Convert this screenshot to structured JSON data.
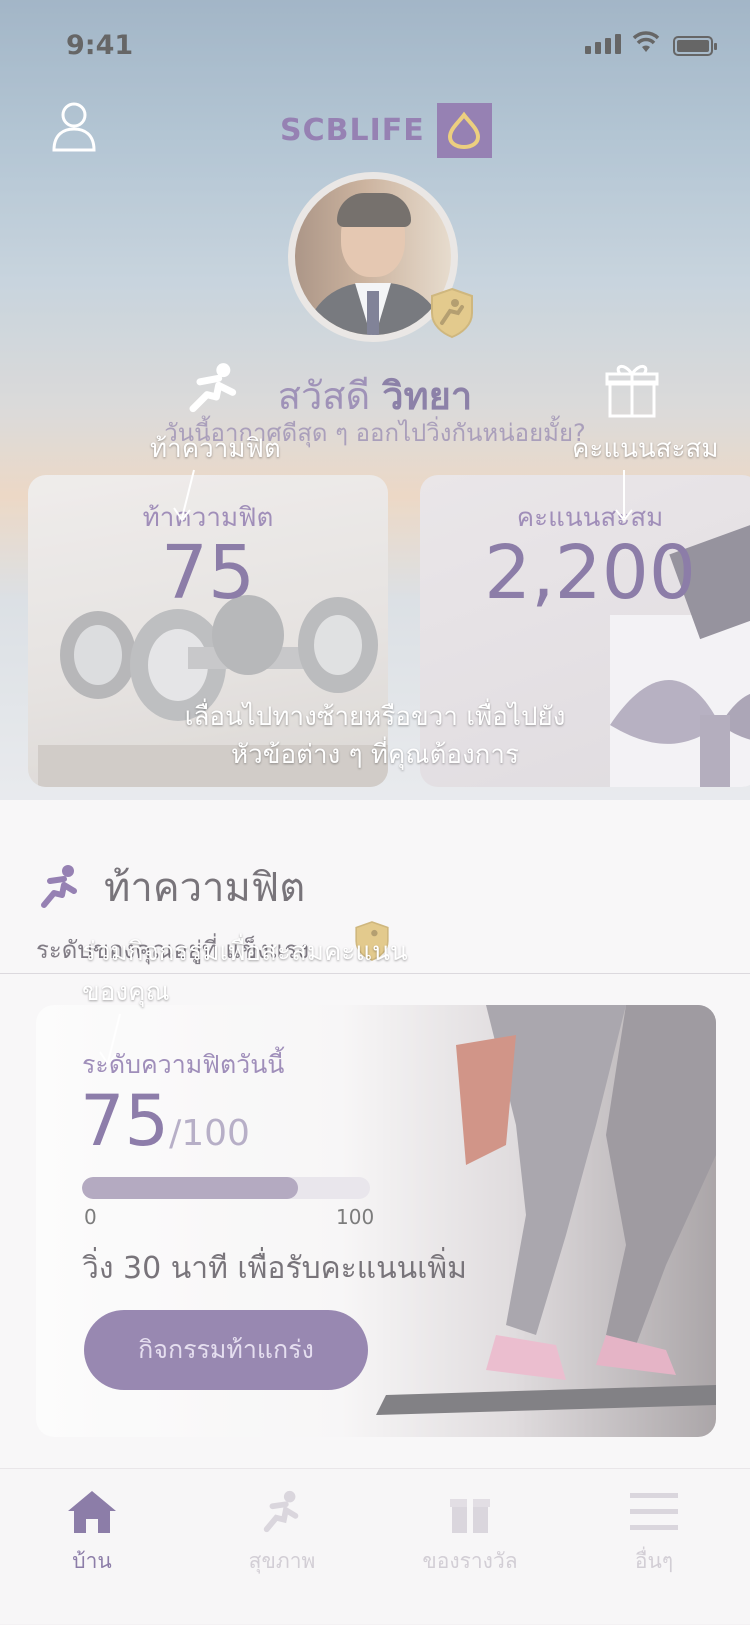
{
  "status": {
    "time": "9:41"
  },
  "header": {
    "logo_text": "SCBLIFE"
  },
  "greeting": {
    "prefix": "สวัสดี",
    "name": "วิทยา",
    "subtitle": "วันนี้อากาศดีสุด ๆ ออกไปวิ่งกันหน่อยมั้ย?"
  },
  "cards": [
    {
      "label": "ท้าความฟิต",
      "value": "75"
    },
    {
      "label": "คะแนนสะสม",
      "value": "2,200"
    }
  ],
  "section": {
    "title": "ท้าความฟิต",
    "subtitle": "ระดับของคุณอยู่ที่ แข็งแรง"
  },
  "fitness": {
    "label": "ระดับความฟิตวันนี้",
    "score": "75",
    "max": "/100",
    "progress": 0.75,
    "range_min": "0",
    "range_max": "100",
    "note": "วิ่ง 30 นาที เพื่อรับคะแนนเพิ่ม",
    "button": "กิจกรรมท้าแกร่ง"
  },
  "tabs": [
    {
      "label": "บ้าน",
      "icon": "home-icon",
      "active": true
    },
    {
      "label": "สุขภาพ",
      "icon": "runner-icon",
      "active": false
    },
    {
      "label": "ของรางวัล",
      "icon": "gift-icon",
      "active": false
    },
    {
      "label": "อื่นๆ",
      "icon": "menu-icon",
      "active": false
    }
  ],
  "coachmarks": {
    "fit": "ท้าความฟิต",
    "points": "คะแนนสะสม",
    "swipe_line1": "เลื่อนไปทางซ้ายหรือขวา เพื่อไปยัง",
    "swipe_line2": "หัวข้อต่าง ๆ ที่คุณต้องการ",
    "join_line1": "ร่วมกิจกรรมเพื่อสะสมคะแนน",
    "join_line2": "ของคุณ"
  },
  "colors": {
    "brand": "#5b3a88",
    "accent_gold": "#c9a13c"
  }
}
